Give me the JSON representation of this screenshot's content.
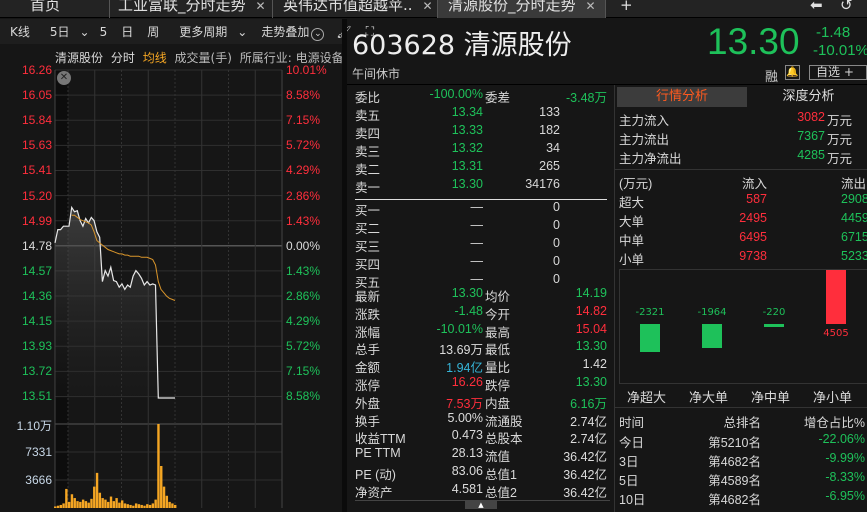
{
  "tabs": [
    {
      "label": "首页"
    },
    {
      "label": "工业富联_分时走势"
    },
    {
      "label": "英伟达市值超越苹.."
    },
    {
      "label": "清源股份_分时走势"
    }
  ],
  "add_tab": "+",
  "toolbar": {
    "kline": "K线",
    "days": "5日",
    "five": "5",
    "day": "日",
    "week": "周",
    "more": "更多周期",
    "overlay": "走势叠加"
  },
  "chart_info": {
    "name": "清源股份",
    "minute": "分时",
    "avg": "均线",
    "volume": "成交量(手)",
    "industry": "所属行业: 电源设备"
  },
  "chart_data": {
    "type": "line",
    "y_ticks": [
      "16.26",
      "16.05",
      "15.84",
      "15.63",
      "15.41",
      "15.20",
      "14.99",
      "14.78",
      "14.57",
      "14.36",
      "14.15",
      "13.93",
      "13.72",
      "13.51"
    ],
    "pct_ticks": [
      "10.01%",
      "8.58%",
      "7.15%",
      "5.72%",
      "4.29%",
      "2.86%",
      "1.43%",
      "0.00%",
      "1.43%",
      "2.86%",
      "4.29%",
      "5.72%",
      "7.15%",
      "8.58%"
    ],
    "ylim": [
      13.3,
      16.26
    ],
    "prev_close": 14.78,
    "vol_ticks": [
      "1.10万",
      "7331",
      "3666"
    ],
    "vol_max": 11000,
    "price": [
      14.7,
      14.82,
      14.82,
      14.85,
      14.85,
      14.85,
      15.02,
      14.98,
      14.99,
      14.9,
      14.85,
      14.92,
      14.88,
      14.93,
      14.9,
      14.8,
      14.75,
      14.35,
      14.45,
      14.4,
      14.48,
      14.36,
      14.35,
      14.3,
      14.33,
      14.28,
      14.32,
      14.3,
      14.4,
      14.45,
      14.42,
      14.38,
      14.32,
      14.35,
      14.32,
      14.33,
      14.32,
      13.3,
      13.3,
      13.3,
      13.3,
      13.3,
      13.3,
      13.3
    ],
    "avg": [
      null,
      null,
      null,
      null,
      null,
      null,
      14.95,
      14.95,
      14.93,
      14.91,
      14.9,
      14.89,
      14.88,
      14.86,
      14.8,
      14.72,
      14.7,
      14.68,
      14.66,
      14.64,
      14.63,
      14.62,
      14.61,
      14.6,
      14.6,
      14.59,
      14.59,
      14.58,
      14.58,
      14.58,
      14.58,
      14.57,
      14.57,
      14.57,
      14.56,
      14.55,
      14.5,
      14.35,
      14.28,
      14.25,
      14.22,
      14.2,
      14.19,
      14.18
    ],
    "volume": [
      200,
      300,
      400,
      600,
      2500,
      800,
      1800,
      1300,
      900,
      800,
      1100,
      900,
      700,
      1200,
      2800,
      4600,
      2000,
      1300,
      1100,
      800,
      1500,
      900,
      1300,
      700,
      1000,
      600,
      500,
      400,
      300,
      600,
      500,
      400,
      300,
      500,
      400,
      600,
      1100,
      11000,
      5500,
      2800,
      1600,
      800,
      600,
      400
    ]
  },
  "quote": {
    "code": "603628",
    "name": "清源股份",
    "status": "午间休市",
    "price": "13.30",
    "change": "-1.48",
    "change_pct": "-10.01%",
    "margin": "融",
    "watch": "自选 +"
  },
  "orderbook": {
    "ratio_label": "委比",
    "ratio": "-100.00%",
    "diff_label": "委差",
    "diff": "-3.48万",
    "asks": [
      {
        "label": "卖五",
        "price": "13.34",
        "vol": "133"
      },
      {
        "label": "卖四",
        "price": "13.33",
        "vol": "182"
      },
      {
        "label": "卖三",
        "price": "13.32",
        "vol": "34"
      },
      {
        "label": "卖二",
        "price": "13.31",
        "vol": "265"
      },
      {
        "label": "卖一",
        "price": "13.30",
        "vol": "34176"
      }
    ],
    "bids": [
      {
        "label": "买一",
        "price": "—",
        "vol": "0"
      },
      {
        "label": "买二",
        "price": "—",
        "vol": "0"
      },
      {
        "label": "买三",
        "price": "—",
        "vol": "0"
      },
      {
        "label": "买四",
        "price": "—",
        "vol": "0"
      },
      {
        "label": "买五",
        "price": "—",
        "vol": "0"
      }
    ]
  },
  "stats": [
    {
      "l1": "最新",
      "v1": "13.30",
      "c1": "green",
      "l2": "均价",
      "v2": "14.19",
      "c2": "green"
    },
    {
      "l1": "涨跌",
      "v1": "-1.48",
      "c1": "green",
      "l2": "今开",
      "v2": "14.82",
      "c2": "red"
    },
    {
      "l1": "涨幅",
      "v1": "-10.01%",
      "c1": "green",
      "l2": "最高",
      "v2": "15.04",
      "c2": "red"
    },
    {
      "l1": "总手",
      "v1": "13.69万",
      "c1": "white",
      "l2": "最低",
      "v2": "13.30",
      "c2": "green"
    },
    {
      "l1": "金额",
      "v1": "1.94亿",
      "c1": "cyan",
      "l2": "量比",
      "v2": "1.42",
      "c2": "white"
    },
    {
      "l1": "涨停",
      "v1": "16.26",
      "c1": "red",
      "l2": "跌停",
      "v2": "13.30",
      "c2": "green"
    },
    {
      "l1": "外盘",
      "v1": "7.53万",
      "c1": "red",
      "l2": "内盘",
      "v2": "6.16万",
      "c2": "green"
    },
    {
      "l1": "换手",
      "v1": "5.00%",
      "c1": "white",
      "l2": "流通股",
      "v2": "2.74亿",
      "c2": "white"
    },
    {
      "l1": "收益TTM",
      "v1": "0.473",
      "c1": "white",
      "l2": "总股本",
      "v2": "2.74亿",
      "c2": "white"
    },
    {
      "l1": "PE TTM",
      "v1": "28.13",
      "c1": "white",
      "l2": "流值",
      "v2": "36.42亿",
      "c2": "white"
    },
    {
      "l1": "PE (动)",
      "v1": "83.06",
      "c1": "white",
      "l2": "总值1",
      "v2": "36.42亿",
      "c2": "white"
    },
    {
      "l1": "净资产",
      "v1": "4.581",
      "c1": "white",
      "l2": "总值2",
      "v2": "36.42亿",
      "c2": "white"
    }
  ],
  "analysis": {
    "tab1": "行情分析",
    "tab2": "深度分析",
    "main": [
      {
        "label": "主力流入",
        "value": "3082",
        "unit": "万元",
        "color": "red"
      },
      {
        "label": "主力流出",
        "value": "7367",
        "unit": "万元",
        "color": "green"
      },
      {
        "label": "主力净流出",
        "value": "4285",
        "unit": "万元",
        "color": "green"
      }
    ],
    "flow_header": {
      "unit": "(万元)",
      "in": "流入",
      "out": "流出"
    },
    "flows": [
      {
        "label": "超大",
        "in": "587",
        "out": "2908"
      },
      {
        "label": "大单",
        "in": "2495",
        "out": "4459"
      },
      {
        "label": "中单",
        "in": "6495",
        "out": "6715"
      },
      {
        "label": "小单",
        "in": "9738",
        "out": "5233"
      }
    ],
    "net": [
      {
        "label": "净超大",
        "value": -2321,
        "text": "-2321"
      },
      {
        "label": "净大单",
        "value": -1964,
        "text": "-1964"
      },
      {
        "label": "净中单",
        "value": -220,
        "text": "-220"
      },
      {
        "label": "净小单",
        "value": 4505,
        "text": "4505"
      }
    ],
    "rank_header": {
      "time": "时间",
      "rank": "总排名",
      "pct": "增仓占比%"
    },
    "ranks": [
      {
        "time": "今日",
        "rank": "第5210名",
        "pct": "-22.06%"
      },
      {
        "time": "3日",
        "rank": "第4682名",
        "pct": "-9.99%"
      },
      {
        "time": "5日",
        "rank": "第4589名",
        "pct": "-8.33%"
      },
      {
        "time": "10日",
        "rank": "第4682名",
        "pct": "-6.95%"
      }
    ]
  },
  "colors": {
    "up": "#ff2e3c",
    "down": "#1ec15a",
    "avg_line": "#d9952b",
    "volume": "#f5a623",
    "active_tab": "#ff5a1f"
  }
}
